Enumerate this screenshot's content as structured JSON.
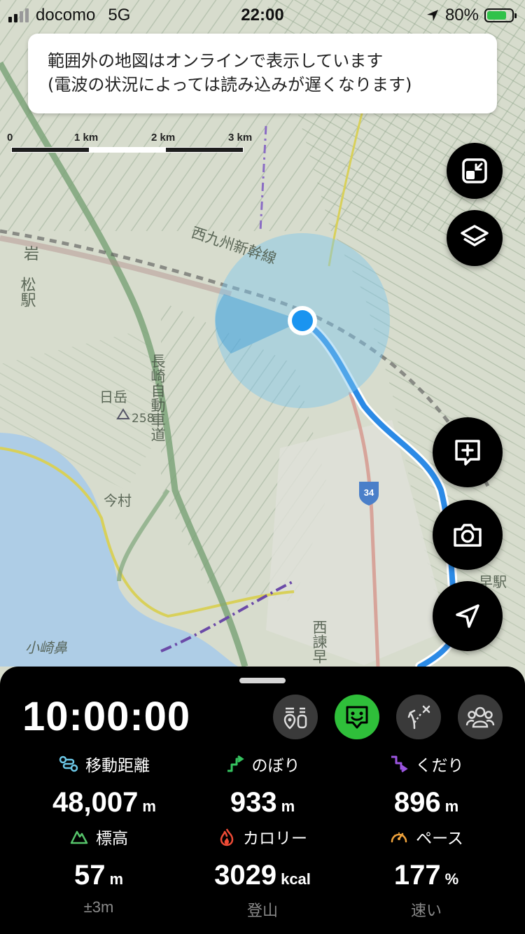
{
  "status_bar": {
    "carrier": "docomo",
    "network": "5G",
    "time": "22:00",
    "battery_percent": "80%",
    "battery_level": 0.8
  },
  "notice": {
    "line1": "範囲外の地図はオンラインで表示しています",
    "line2": "(電波の状況によっては読み込みが遅くなります)"
  },
  "map": {
    "labels": {
      "station_left": "松駅",
      "station_left_prefix": "岩",
      "shinkansen": "西九州新幹線",
      "expressway": "長崎自動車道",
      "mountain": "日岳",
      "peak_elevation": "258",
      "town": "今村",
      "cape": "小崎鼻",
      "road_number": "34",
      "isahaya": "西諫早",
      "station_right": "早駅"
    },
    "scale": {
      "ticks": [
        "0",
        "1 km",
        "2 km",
        "3 km"
      ]
    },
    "colors": {
      "route": "#2b8ae6",
      "location": "#1a94f0",
      "sea": "#aecde6"
    }
  },
  "map_controls": {
    "fullscreen_icon": "fullscreen-exit-icon",
    "layers_icon": "layers-icon",
    "memo_icon": "add-memo-icon",
    "camera_icon": "camera-icon",
    "locate_icon": "navigation-arrow-icon"
  },
  "panel": {
    "timer": "10:00:00",
    "modes": [
      "checkpoint-icon",
      "face-icon",
      "route-deviation-icon",
      "group-icon"
    ],
    "active_mode_color": "#2fbf3a",
    "stats": [
      {
        "label": "移動距離",
        "value": "48,007",
        "unit": "m",
        "icon": "distance-icon",
        "icon_color": "#6cc7e6"
      },
      {
        "label": "のぼり",
        "value": "933",
        "unit": "m",
        "icon": "ascent-icon",
        "icon_color": "#35c25f"
      },
      {
        "label": "くだり",
        "value": "896",
        "unit": "m",
        "icon": "descent-icon",
        "icon_color": "#9b55e0"
      },
      {
        "label": "標高",
        "value": "57",
        "unit": "m",
        "sub": "±3m",
        "icon": "elevation-icon",
        "icon_color": "#56c46a"
      },
      {
        "label": "カロリー",
        "value": "3029",
        "unit": "kcal",
        "sub": "登山",
        "icon": "flame-icon",
        "icon_color": "#ef4b36"
      },
      {
        "label": "ペース",
        "value": "177",
        "unit": "%",
        "sub": "速い",
        "icon": "speedometer-icon",
        "icon_color": "#f0a33c"
      }
    ]
  }
}
